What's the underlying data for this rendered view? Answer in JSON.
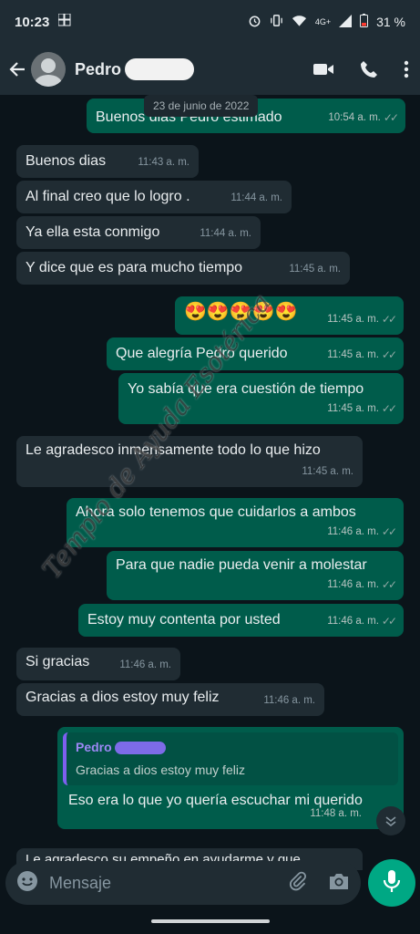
{
  "status_bar": {
    "time": "10:23",
    "network": "4G+",
    "battery": "31 %"
  },
  "header": {
    "name": "Pedro"
  },
  "date_chip": "23 de junio de 2022",
  "messages": [
    {
      "text": "Buenos dias Pedro estimado",
      "time": "10:54 a. m."
    },
    {
      "text": "Buenos dias",
      "time": "11:43 a. m."
    },
    {
      "text": "Al final creo que lo logro .",
      "time": "11:44 a. m."
    },
    {
      "text": "Ya ella esta conmigo",
      "time": "11:44 a. m."
    },
    {
      "text": "Y dice que es para mucho tiempo",
      "time": "11:45 a. m."
    },
    {
      "text": "😍😍😍😍😍",
      "time": "11:45 a. m."
    },
    {
      "text": "Que alegría Pedro querido",
      "time": "11:45 a. m."
    },
    {
      "text": "Yo sabía que era cuestión de tiempo",
      "time": "11:45 a. m."
    },
    {
      "text": "Le agradesco inmensamente todo lo que hizo",
      "time": "11:45 a. m."
    },
    {
      "text": "Ahora solo tenemos que cuidarlos a ambos",
      "time": "11:46 a. m."
    },
    {
      "text": "Para que nadie pueda venir a molestar",
      "time": "11:46 a. m."
    },
    {
      "text": "Estoy muy contenta por usted",
      "time": "11:46 a. m."
    },
    {
      "text": "Si gracias",
      "time": "11:46 a. m."
    },
    {
      "text": "Gracias a dios estoy muy feliz",
      "time": "11:46 a. m."
    },
    {
      "quote_name": "Pedro",
      "quote_text": "Gracias a dios estoy muy feliz",
      "text": "Eso era lo que yo quería escuchar mi querido",
      "time": "11:48 a. m."
    }
  ],
  "partial_message": "Le agradesco su empeño en ayudarme y que",
  "input": {
    "placeholder": "Mensaje"
  },
  "watermark": "Templo de Ayuda Esotérica",
  "colors": {
    "incoming": "#202c33",
    "outgoing": "#005c4b",
    "accent": "#00a884",
    "background": "#0b141a"
  }
}
